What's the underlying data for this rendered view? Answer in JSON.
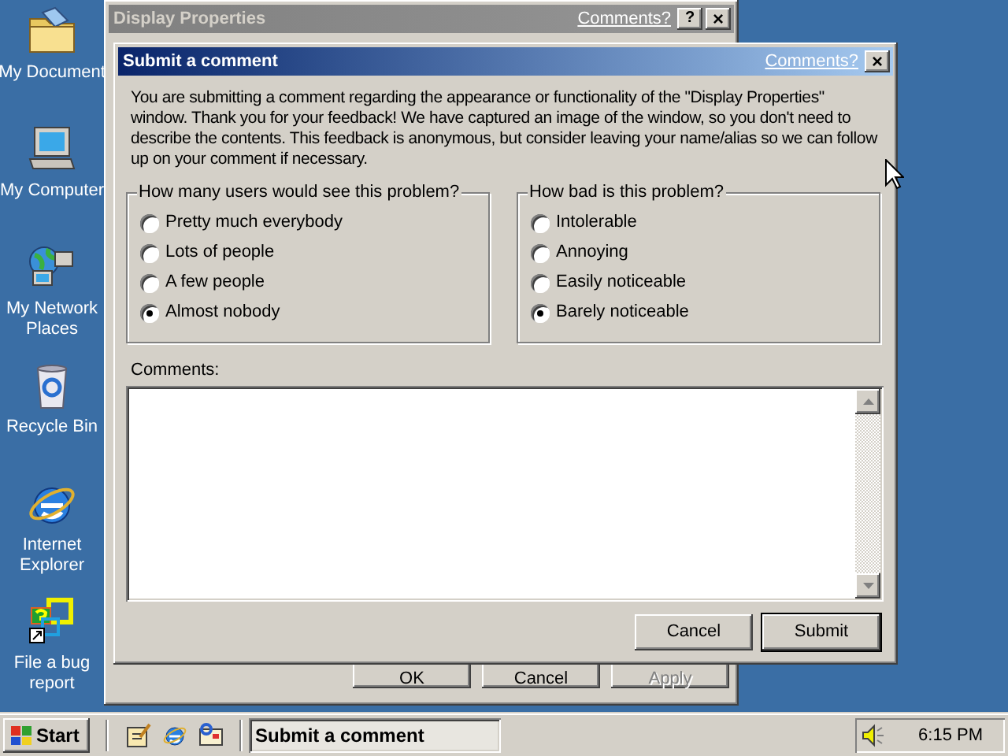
{
  "desktop_icons": [
    {
      "label": "My Document",
      "kind": "documents"
    },
    {
      "label": "My Computer",
      "kind": "computer"
    },
    {
      "label": "My Network Places",
      "kind": "network"
    },
    {
      "label": "Recycle Bin",
      "kind": "recycle"
    },
    {
      "label": "Internet Explorer",
      "kind": "browser"
    },
    {
      "label": "File a bug report",
      "kind": "bug"
    }
  ],
  "background_window": {
    "title": "Display Properties",
    "comments_link": "Comments?",
    "help": "?",
    "close": "×",
    "buttons": [
      {
        "label": "OK",
        "disabled": false
      },
      {
        "label": "Cancel",
        "disabled": false
      },
      {
        "label": "Apply",
        "disabled": true
      }
    ]
  },
  "dialog": {
    "title": "Submit a comment",
    "comments_link": "Comments?",
    "close": "×",
    "message": "You are submitting a comment regarding the appearance or functionality of the \"Display Properties\" window. Thank you for your feedback! We have captured an image of the window, so you don't need to describe the contents. This feedback is anonymous, but consider leaving your name/alias so we can follow up on your comment if necessary.",
    "groups": [
      {
        "label": "How many users would see this problem?",
        "options": [
          {
            "label": "Pretty much everybody",
            "selected": false
          },
          {
            "label": "Lots of people",
            "selected": false
          },
          {
            "label": "A few people",
            "selected": false
          },
          {
            "label": "Almost nobody",
            "selected": true
          }
        ]
      },
      {
        "label": "How bad is this problem?",
        "options": [
          {
            "label": "Intolerable",
            "selected": false
          },
          {
            "label": "Annoying",
            "selected": false
          },
          {
            "label": "Easily noticeable",
            "selected": false
          },
          {
            "label": "Barely noticeable",
            "selected": true
          }
        ]
      }
    ],
    "comments_label": "Comments:",
    "buttons": [
      {
        "label": "Cancel",
        "default": false
      },
      {
        "label": "Submit",
        "default": true
      }
    ]
  },
  "taskbar": {
    "start": "Start",
    "quick_launch": [
      {
        "kind": "desktop"
      },
      {
        "kind": "browser"
      },
      {
        "kind": "channels"
      }
    ],
    "tasks": [
      {
        "label": "Submit a comment",
        "selected": true
      }
    ],
    "clock": "6:15 PM"
  }
}
